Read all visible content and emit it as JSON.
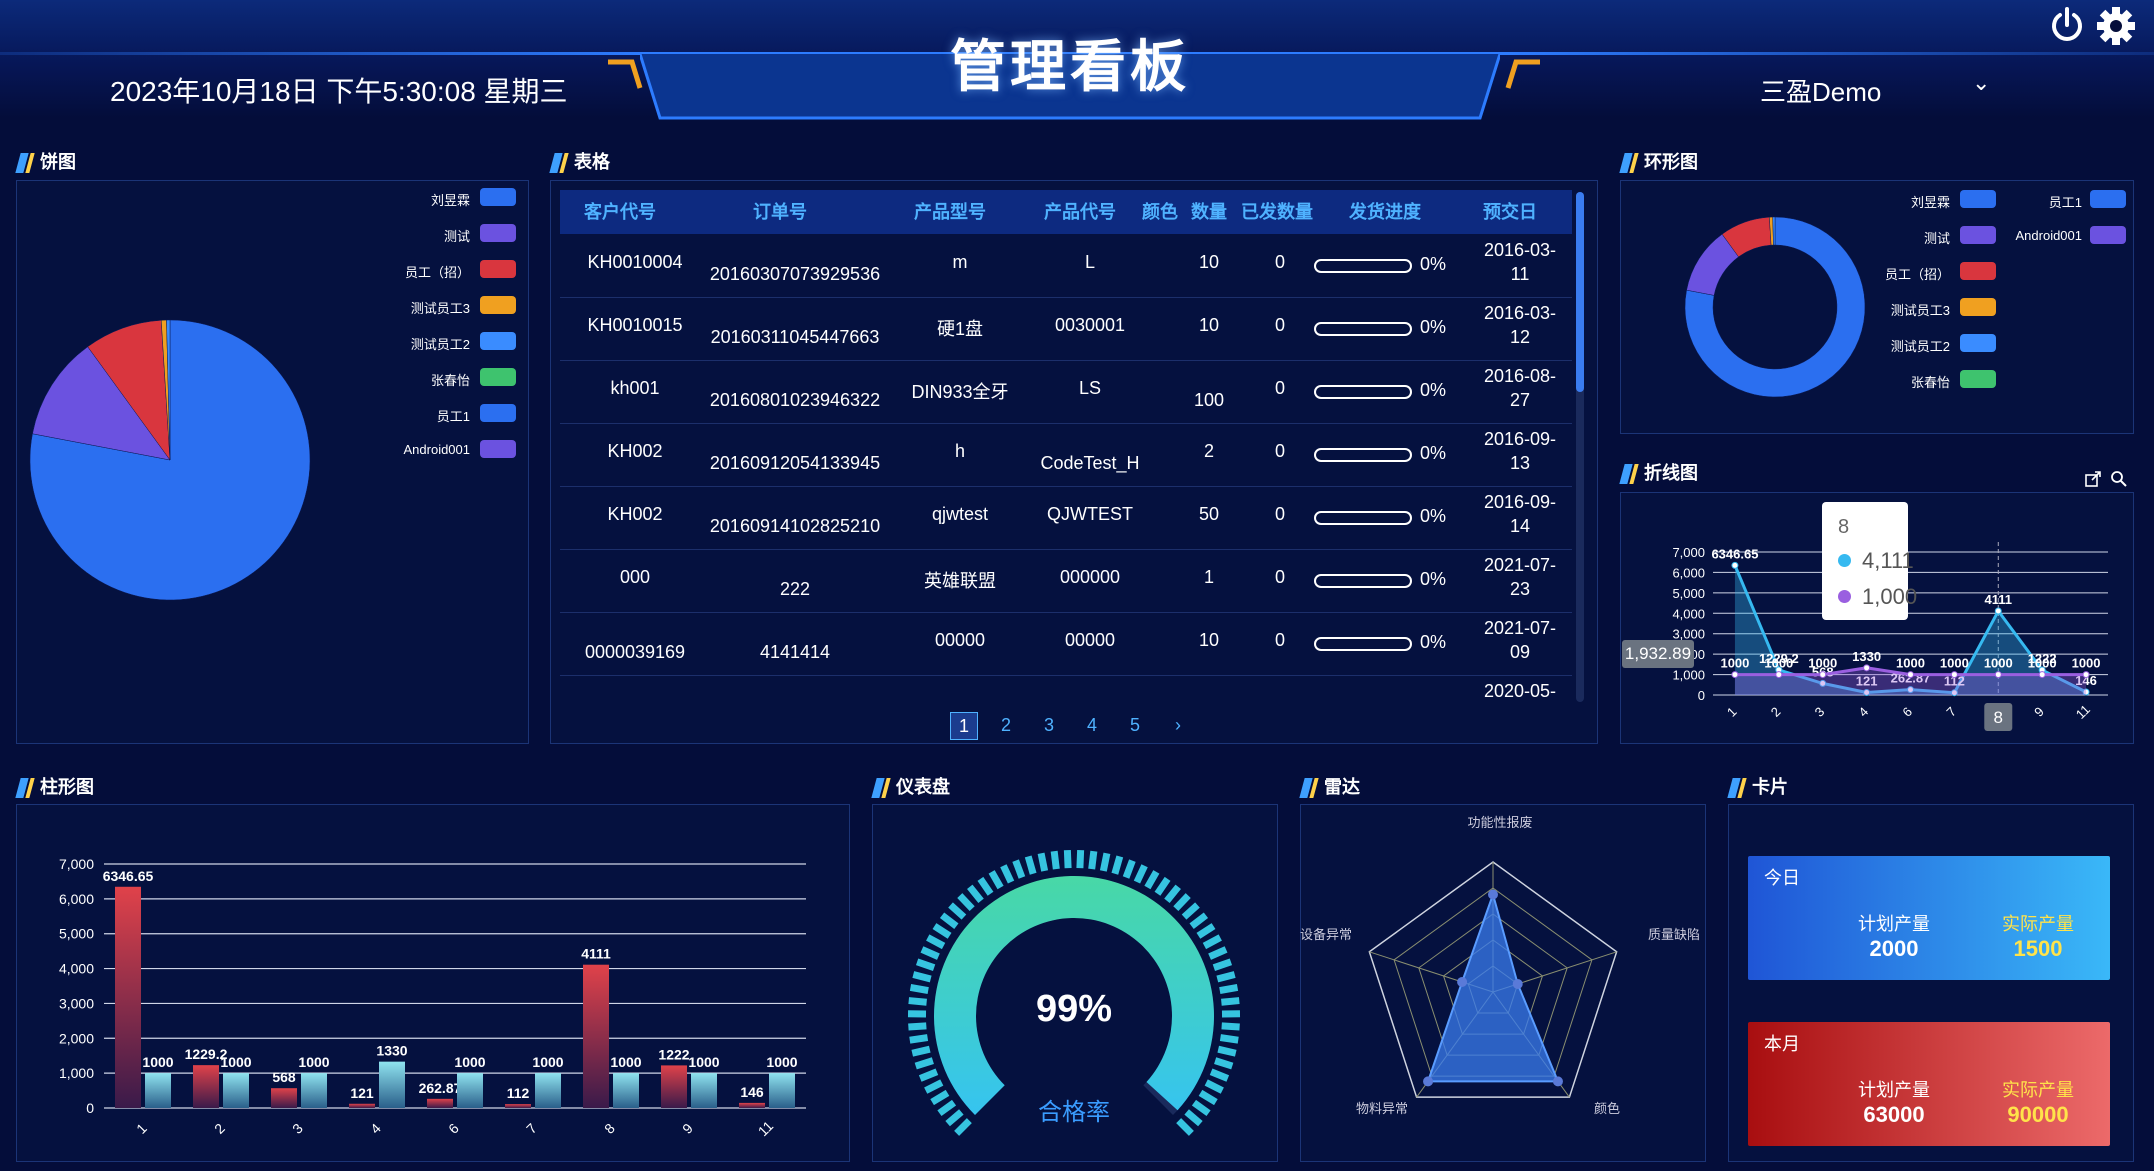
{
  "header": {
    "title": "管理看板",
    "datetime": "2023年10月18日 下午5:30:08 星期三",
    "user": "三盈Demo"
  },
  "icons": {
    "power": "power-icon",
    "settings": "gear-icon",
    "caret": "chevron-down-icon",
    "export": "export-icon",
    "zoom": "zoom-icon"
  },
  "colors": {
    "accent": "#3ea0ff",
    "background": "#040d3a",
    "panel_border": "#1b3477",
    "red_bar": "#d9363e",
    "cyan_bar": "#7fd8e6"
  },
  "panels": {
    "pie": "饼图",
    "table": "表格",
    "donut": "环形图",
    "line": "折线图",
    "bar": "柱形图",
    "gauge": "仪表盘",
    "radar": "雷达",
    "card": "卡片"
  },
  "legend": {
    "pie": [
      {
        "name": "刘昱霖",
        "color": "#2b6ff0"
      },
      {
        "name": "测试",
        "color": "#6b52e0"
      },
      {
        "name": "员工（招）",
        "color": "#d9363e"
      },
      {
        "name": "测试员工3",
        "color": "#f0a020"
      },
      {
        "name": "测试员工2",
        "color": "#3a8cff"
      },
      {
        "name": "张春怡",
        "color": "#3ec36e"
      },
      {
        "name": "员工1",
        "color": "#2b6ff0"
      },
      {
        "name": "Android001",
        "color": "#6b52e0"
      }
    ],
    "donut_left": [
      {
        "name": "刘昱霖",
        "color": "#2b6ff0"
      },
      {
        "name": "测试",
        "color": "#6b52e0"
      },
      {
        "name": "员工（招）",
        "color": "#d9363e"
      },
      {
        "name": "测试员工3",
        "color": "#f0a020"
      },
      {
        "name": "测试员工2",
        "color": "#3a8cff"
      },
      {
        "name": "张春怡",
        "color": "#3ec36e"
      }
    ],
    "donut_right": [
      {
        "name": "员工1",
        "color": "#2b6ff0"
      },
      {
        "name": "Android001",
        "color": "#6b52e0"
      }
    ]
  },
  "table": {
    "columns": [
      "客户代号",
      "订单号",
      "产品型号",
      "产品代号",
      "颜色",
      "数量",
      "已发数量",
      "发货进度",
      "预交日"
    ],
    "rows": [
      {
        "customer": "KH0010004",
        "order": "20160307073929536",
        "model": "m",
        "code": "L",
        "color": "",
        "qty": "10",
        "shipped": "0",
        "progress": "0%",
        "due1": "2016-03-",
        "due2": "11"
      },
      {
        "customer": "KH0010015",
        "order": "20160311045447663",
        "model": "硬1盘",
        "code": "0030001",
        "color": "",
        "qty": "10",
        "shipped": "0",
        "progress": "0%",
        "due1": "2016-03-",
        "due2": "12"
      },
      {
        "customer": "kh001",
        "order": "20160801023946322",
        "model": "DIN933全牙",
        "code": "LS",
        "color": "",
        "qty": "100",
        "shipped": "0",
        "progress": "0%",
        "due1": "2016-08-",
        "due2": "27"
      },
      {
        "customer": "KH002",
        "order": "20160912054133945",
        "model": "h",
        "code": "CodeTest_H",
        "color": "",
        "qty": "2",
        "shipped": "0",
        "progress": "0%",
        "due1": "2016-09-",
        "due2": "13"
      },
      {
        "customer": "KH002",
        "order": "20160914102825210",
        "model": "qjwtest",
        "code": "QJWTEST",
        "color": "",
        "qty": "50",
        "shipped": "0",
        "progress": "0%",
        "due1": "2016-09-",
        "due2": "14"
      },
      {
        "customer": "000",
        "order": "222",
        "model": "英雄联盟",
        "code": "000000",
        "color": "",
        "qty": "1",
        "shipped": "0",
        "progress": "0%",
        "due1": "2021-07-",
        "due2": "23"
      },
      {
        "customer": "0000039169",
        "order": "4141414",
        "model": "00000",
        "code": "00000",
        "color": "",
        "qty": "10",
        "shipped": "0",
        "progress": "0%",
        "due1": "2021-07-",
        "due2": "09"
      },
      {
        "customer": "",
        "order": "",
        "model": "",
        "code": "",
        "color": "",
        "qty": "",
        "shipped": "",
        "progress": "",
        "due1": "2020-05-",
        "due2": ""
      }
    ],
    "pages": [
      "1",
      "2",
      "3",
      "4",
      "5",
      "›"
    ]
  },
  "chart_data": [
    {
      "type": "pie",
      "title": "饼图",
      "labels": [
        "刘昱霖",
        "测试",
        "员工（招）",
        "测试员工3",
        "测试员工2",
        "张春怡",
        "员工1",
        "Android001"
      ],
      "values": [
        78,
        12,
        9,
        0.6,
        0.4,
        0,
        0,
        0
      ],
      "colors": [
        "#2b6ff0",
        "#6b52e0",
        "#d9363e",
        "#f0a020",
        "#3a8cff",
        "#3ec36e",
        "#2b6ff0",
        "#6b52e0"
      ]
    },
    {
      "type": "pie",
      "title": "环形图",
      "labels": [
        "刘昱霖",
        "测试",
        "员工（招）",
        "测试员工3",
        "测试员工2",
        "张春怡",
        "员工1",
        "Android001"
      ],
      "values": [
        78,
        12,
        9,
        0.6,
        0.4,
        0,
        0,
        0
      ],
      "colors": [
        "#2b6ff0",
        "#6b52e0",
        "#d9363e",
        "#f0a020",
        "#3a8cff",
        "#3ec36e",
        "#2b6ff0",
        "#6b52e0"
      ]
    },
    {
      "type": "line",
      "title": "折线图",
      "categories": [
        "1",
        "2",
        "3",
        "4",
        "6",
        "7",
        "8",
        "9",
        "11"
      ],
      "series": [
        {
          "values": [
            6346.65,
            1229.2,
            568,
            121,
            262.87,
            112,
            4111,
            1222,
            146
          ],
          "color": "#36b9f0"
        },
        {
          "values": [
            1000,
            1000,
            1000,
            1330,
            1000,
            1000,
            1000,
            1000,
            1000
          ],
          "color": "#9a5fe0"
        }
      ],
      "yticks": [
        "0",
        "1,000",
        "2,000",
        "3,000",
        "4,000",
        "5,000",
        "6,000",
        "7,000"
      ],
      "ylim": [
        0,
        7000
      ],
      "tooltip": {
        "category": "8",
        "values": [
          "4,111",
          "1,000"
        ],
        "y_pointer": "1,932.89"
      }
    },
    {
      "type": "bar",
      "title": "柱形图",
      "categories": [
        "1",
        "2",
        "3",
        "4",
        "6",
        "7",
        "8",
        "9",
        "11"
      ],
      "series": [
        {
          "values": [
            6346.65,
            1229.2,
            568,
            121,
            262.87,
            112,
            4111,
            1222,
            146
          ],
          "color": "#d9363e"
        },
        {
          "values": [
            1000,
            1000,
            1000,
            1330,
            1000,
            1000,
            1000,
            1000,
            1000
          ],
          "color": "#7fd8e6"
        }
      ],
      "yticks": [
        "0",
        "1,000",
        "2,000",
        "3,000",
        "4,000",
        "5,000",
        "6,000",
        "7,000"
      ],
      "ylim": [
        0,
        7000
      ]
    },
    {
      "type": "gauge",
      "title": "仪表盘",
      "value": 99,
      "value_text": "99%",
      "label": "合格率"
    },
    {
      "type": "radar",
      "title": "雷达",
      "indicators": [
        "功能性报废",
        "质量缺陷",
        "颜色",
        "物料异常",
        "设备异常"
      ],
      "values": [
        0.75,
        0.2,
        0.85,
        0.85,
        0.25
      ]
    }
  ],
  "cards": [
    {
      "period": "今日",
      "plan_label": "计划产量",
      "plan": "2000",
      "actual_label": "实际产量",
      "actual": "1500"
    },
    {
      "period": "本月",
      "plan_label": "计划产量",
      "plan": "63000",
      "actual_label": "实际产量",
      "actual": "90000"
    }
  ]
}
